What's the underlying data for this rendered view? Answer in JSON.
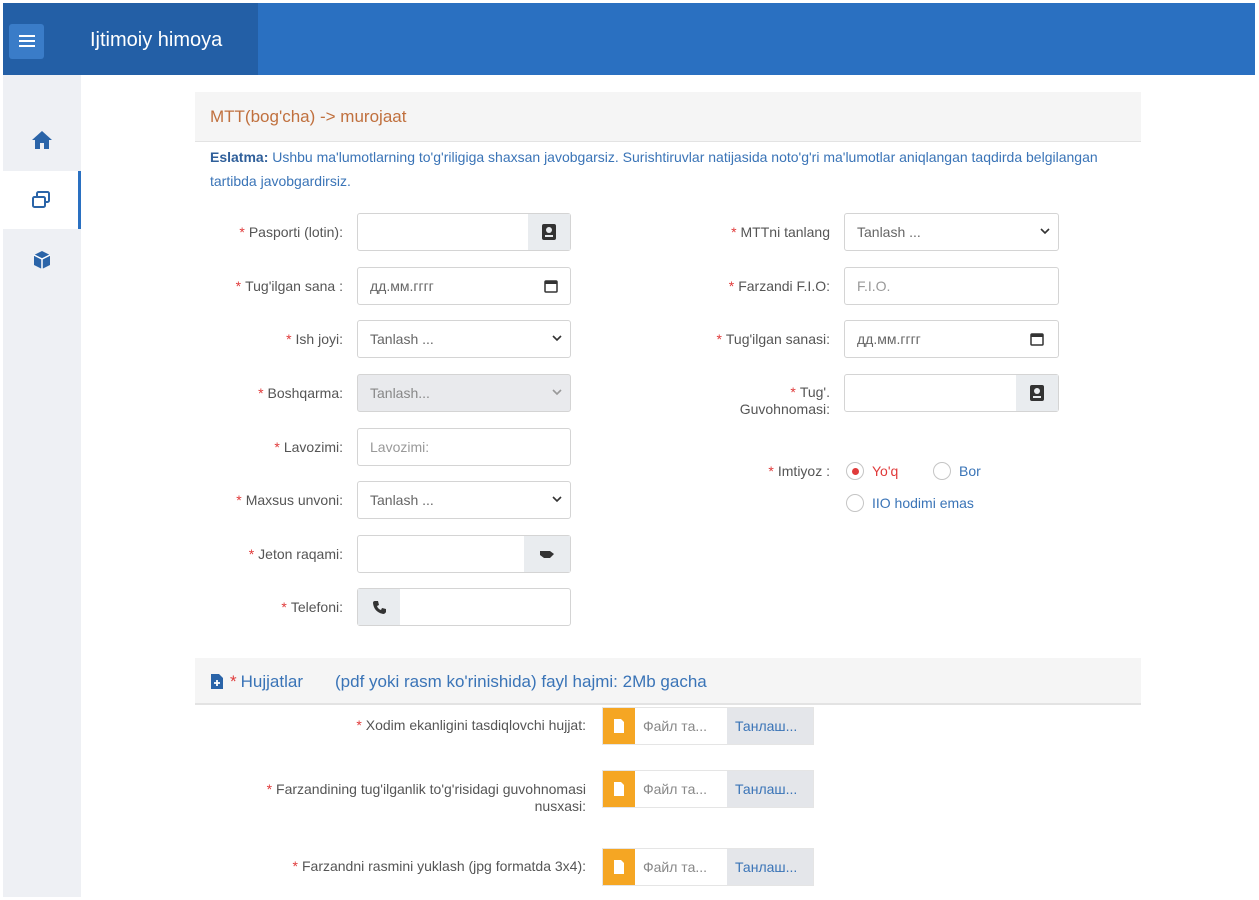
{
  "app": {
    "title": "Ijtimoiy himoya"
  },
  "sidebar": {
    "items": [
      {
        "icon": "home-icon"
      },
      {
        "icon": "windows-icon"
      },
      {
        "icon": "cube-icon"
      }
    ]
  },
  "page": {
    "title": "MTT(bog'cha) -> murojaat",
    "note_label": "Eslatma:",
    "note_text": "Ushbu ma'lumotlarning to'g'riligiga shaxsan javobgarsiz. Surishtiruvlar natijasida noto'g'ri ma'lumotlar aniqlangan taqdirda belgilangan tartibda javobgardirsiz."
  },
  "form": {
    "left": {
      "passport": {
        "label": "Pasporti (lotin):",
        "value": ""
      },
      "birth_date": {
        "label": "Tug'ilgan sana :",
        "placeholder": "дд.мм.гггг"
      },
      "workplace": {
        "label": "Ish joyi:",
        "selected": "Tanlash ..."
      },
      "department": {
        "label": "Boshqarma:",
        "selected": "Tanlash..."
      },
      "position": {
        "label": "Lavozimi:",
        "placeholder": "Lavozimi:"
      },
      "rank": {
        "label": "Maxsus unvoni:",
        "selected": "Tanlash ..."
      },
      "token": {
        "label": "Jeton raqami:",
        "value": ""
      },
      "phone": {
        "label": "Telefoni:",
        "value": ""
      }
    },
    "right": {
      "mtt": {
        "label": "MTTni tanlang",
        "selected": "Tanlash ..."
      },
      "child_name": {
        "label": "Farzandi F.I.O:",
        "placeholder": "F.I.O."
      },
      "child_birth": {
        "label": "Tug'ilgan sanasi:",
        "placeholder": "дд.мм.гггг"
      },
      "certificate": {
        "label_line1": "Tug'.",
        "label_line2": "Guvohnomasi:",
        "value": ""
      },
      "privilege": {
        "label": "Imtiyoz :",
        "options": [
          {
            "label": "Yo'q",
            "checked": true
          },
          {
            "label": "Bor",
            "checked": false
          },
          {
            "label": "IIO hodimi emas",
            "checked": false
          }
        ]
      }
    }
  },
  "documents": {
    "title": "Hujjatlar",
    "subtitle": "(pdf yoki rasm ko'rinishida) fayl hajmi: 2Mb gacha",
    "items": [
      {
        "label": "Xodim ekanligini tasdiqlovchi hujjat:",
        "file_placeholder": "Файл та...",
        "button": "Танлаш..."
      },
      {
        "label_line1": "Farzandining tug'ilganlik to'g'risidagi guvohnomasi",
        "label_line2": "nusxasi:",
        "file_placeholder": "Файл та...",
        "button": "Танлаш..."
      },
      {
        "label": "Farzandni rasmini yuklash (jpg formatda 3x4):",
        "file_placeholder": "Файл та...",
        "button": "Танлаш..."
      }
    ]
  },
  "required_mark": "*",
  "colors": {
    "header": "#2a70c1",
    "brand": "#235fa6",
    "accent_title": "#c0703e",
    "link": "#3a74b7",
    "required": "#e03a3a",
    "file_icon": "#f5a623"
  }
}
